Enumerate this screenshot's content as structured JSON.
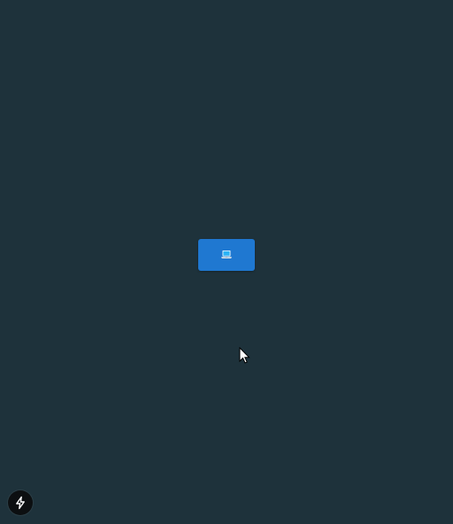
{
  "colors": {
    "background": "#1e323b",
    "button": "#1f78d1",
    "badge": "#0c0f11"
  },
  "center_button": {
    "icon": "laptop-icon"
  },
  "corner_badge": {
    "icon": "bolt-icon"
  },
  "cursor": {
    "icon": "mouse-pointer-icon"
  }
}
